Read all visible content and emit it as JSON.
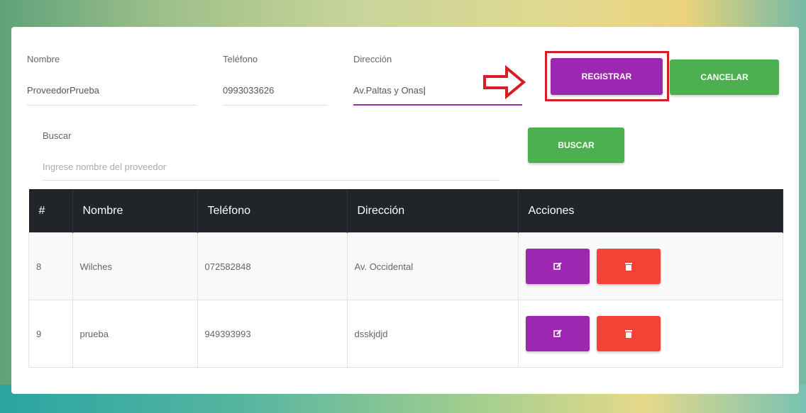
{
  "form": {
    "nombre_label": "Nombre",
    "nombre_value": "ProveedorPrueba",
    "telefono_label": "Teléfono",
    "telefono_value": "0993033626",
    "direccion_label": "Dirección",
    "direccion_value": "Av.Paltas y Onas",
    "registrar_label": "REGISTRAR",
    "cancelar_label": "CANCELAR"
  },
  "search": {
    "label": "Buscar",
    "placeholder": "Ingrese nombre del proveedor",
    "button_label": "BUSCAR"
  },
  "table": {
    "headers": [
      "#",
      "Nombre",
      "Teléfono",
      "Dirección",
      "Acciones"
    ],
    "rows": [
      {
        "id": "8",
        "nombre": "Wilches",
        "telefono": "072582848",
        "direccion": "Av. Occidental"
      },
      {
        "id": "9",
        "nombre": "prueba",
        "telefono": "949393993",
        "direccion": "dsskjdjd"
      }
    ]
  },
  "icons": {
    "edit": "edit-icon",
    "delete": "trash-icon",
    "arrow": "arrow-right-icon"
  },
  "colors": {
    "purple": "#9c27b0",
    "green": "#4caf50",
    "red": "#f44336",
    "highlight": "#d81e25",
    "header_bg": "#212529"
  }
}
